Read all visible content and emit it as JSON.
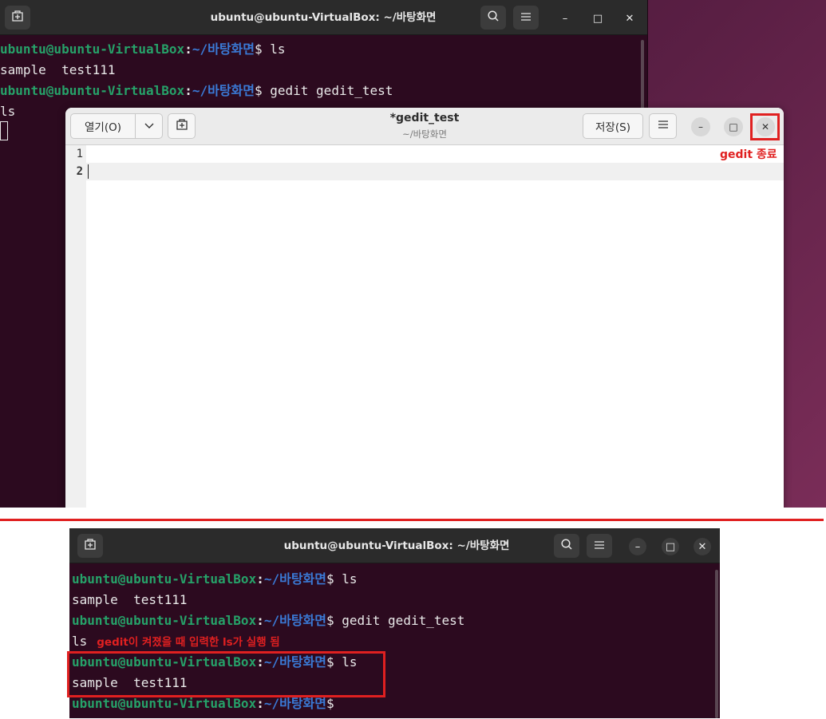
{
  "top_terminal": {
    "title": "ubuntu@ubuntu-VirtualBox: ~/바탕화면",
    "lines": [
      {
        "user": "ubuntu@ubuntu-VirtualBox",
        "colon": ":",
        "path": "~/바탕화면",
        "cmd": "$ ls"
      },
      {
        "text": "sample  test111"
      },
      {
        "user": "ubuntu@ubuntu-VirtualBox",
        "colon": ":",
        "path": "~/바탕화면",
        "cmd": "$ gedit gedit_test"
      },
      {
        "text": "ls"
      }
    ]
  },
  "gedit": {
    "open_label": "열기(O)",
    "title": "*gedit_test",
    "subtitle": "~/바탕화면",
    "save_label": "저장(S)",
    "line_numbers": [
      "1",
      "2"
    ]
  },
  "annotations": {
    "gedit_close": "gedit 종료",
    "ls_note": "gedit이 켜졌을 때 입력한 ls가 실행 됨"
  },
  "bottom_terminal": {
    "title": "ubuntu@ubuntu-VirtualBox: ~/바탕화면",
    "lines": [
      {
        "user": "ubuntu@ubuntu-VirtualBox",
        "colon": ":",
        "path": "~/바탕화면",
        "cmd": "$ ls"
      },
      {
        "text": "sample  test111"
      },
      {
        "user": "ubuntu@ubuntu-VirtualBox",
        "colon": ":",
        "path": "~/바탕화면",
        "cmd": "$ gedit gedit_test"
      },
      {
        "text": "ls"
      },
      {
        "user": "ubuntu@ubuntu-VirtualBox",
        "colon": ":",
        "path": "~/바탕화면",
        "cmd": "$ ls"
      },
      {
        "text": "sample  test111"
      },
      {
        "user": "ubuntu@ubuntu-VirtualBox",
        "colon": ":",
        "path": "~/바탕화면",
        "cmd": "$"
      }
    ]
  },
  "icons": {
    "new_tab": "new-tab-icon",
    "search": "search-icon",
    "menu": "hamburger-menu-icon",
    "minimize": "minimize-icon",
    "maximize": "maximize-icon",
    "close": "close-icon",
    "dropdown": "chevron-down-icon"
  },
  "colors": {
    "prompt_user": "#26a269",
    "prompt_path": "#3a7ad6",
    "terminal_bg": "#2c0a1f",
    "annotation_red": "#e02020"
  }
}
